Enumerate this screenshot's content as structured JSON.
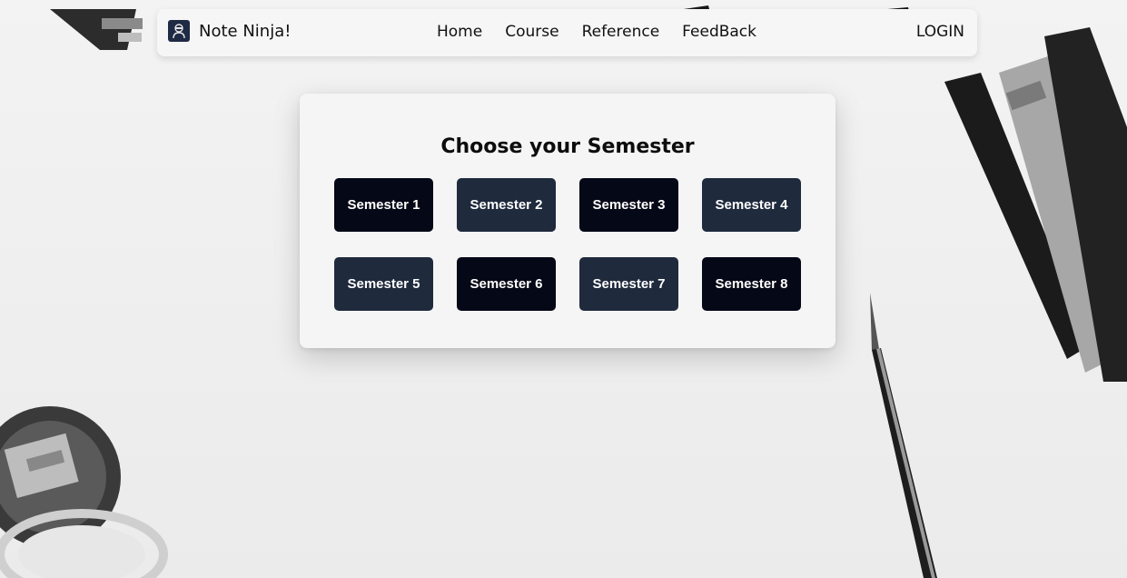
{
  "navbar": {
    "brand": "Note Ninja!",
    "logo_icon": "ninja-logo-icon",
    "links": [
      "Home",
      "Course",
      "Reference",
      "FeedBack"
    ],
    "login": "LOGIN"
  },
  "card": {
    "title": "Choose your Semester",
    "semesters": [
      {
        "label": "Semester 1",
        "color": "#050816"
      },
      {
        "label": "Semester 2",
        "color": "#1f2a3d"
      },
      {
        "label": "Semester 3",
        "color": "#050816"
      },
      {
        "label": "Semester 4",
        "color": "#1f2a3d"
      },
      {
        "label": "Semester 5",
        "color": "#1f2a3d"
      },
      {
        "label": "Semester 6",
        "color": "#050816"
      },
      {
        "label": "Semester 7",
        "color": "#1f2a3d"
      },
      {
        "label": "Semester 8",
        "color": "#050816"
      }
    ]
  }
}
